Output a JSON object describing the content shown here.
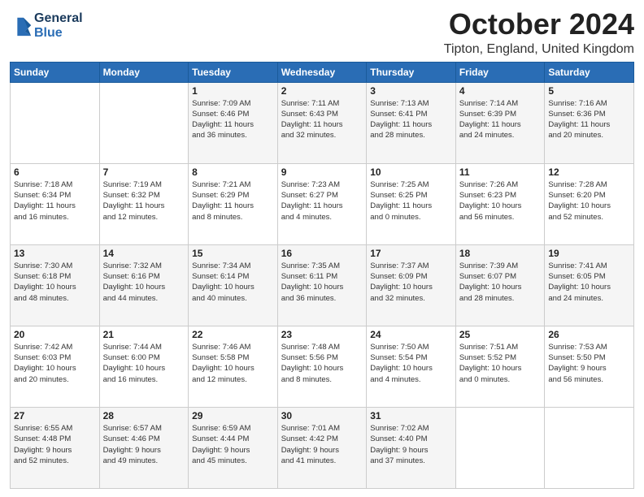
{
  "logo": {
    "line1": "General",
    "line2": "Blue"
  },
  "header": {
    "title": "October 2024",
    "location": "Tipton, England, United Kingdom"
  },
  "weekdays": [
    "Sunday",
    "Monday",
    "Tuesday",
    "Wednesday",
    "Thursday",
    "Friday",
    "Saturday"
  ],
  "weeks": [
    [
      {
        "day": "",
        "info": ""
      },
      {
        "day": "",
        "info": ""
      },
      {
        "day": "1",
        "info": "Sunrise: 7:09 AM\nSunset: 6:46 PM\nDaylight: 11 hours\nand 36 minutes."
      },
      {
        "day": "2",
        "info": "Sunrise: 7:11 AM\nSunset: 6:43 PM\nDaylight: 11 hours\nand 32 minutes."
      },
      {
        "day": "3",
        "info": "Sunrise: 7:13 AM\nSunset: 6:41 PM\nDaylight: 11 hours\nand 28 minutes."
      },
      {
        "day": "4",
        "info": "Sunrise: 7:14 AM\nSunset: 6:39 PM\nDaylight: 11 hours\nand 24 minutes."
      },
      {
        "day": "5",
        "info": "Sunrise: 7:16 AM\nSunset: 6:36 PM\nDaylight: 11 hours\nand 20 minutes."
      }
    ],
    [
      {
        "day": "6",
        "info": "Sunrise: 7:18 AM\nSunset: 6:34 PM\nDaylight: 11 hours\nand 16 minutes."
      },
      {
        "day": "7",
        "info": "Sunrise: 7:19 AM\nSunset: 6:32 PM\nDaylight: 11 hours\nand 12 minutes."
      },
      {
        "day": "8",
        "info": "Sunrise: 7:21 AM\nSunset: 6:29 PM\nDaylight: 11 hours\nand 8 minutes."
      },
      {
        "day": "9",
        "info": "Sunrise: 7:23 AM\nSunset: 6:27 PM\nDaylight: 11 hours\nand 4 minutes."
      },
      {
        "day": "10",
        "info": "Sunrise: 7:25 AM\nSunset: 6:25 PM\nDaylight: 11 hours\nand 0 minutes."
      },
      {
        "day": "11",
        "info": "Sunrise: 7:26 AM\nSunset: 6:23 PM\nDaylight: 10 hours\nand 56 minutes."
      },
      {
        "day": "12",
        "info": "Sunrise: 7:28 AM\nSunset: 6:20 PM\nDaylight: 10 hours\nand 52 minutes."
      }
    ],
    [
      {
        "day": "13",
        "info": "Sunrise: 7:30 AM\nSunset: 6:18 PM\nDaylight: 10 hours\nand 48 minutes."
      },
      {
        "day": "14",
        "info": "Sunrise: 7:32 AM\nSunset: 6:16 PM\nDaylight: 10 hours\nand 44 minutes."
      },
      {
        "day": "15",
        "info": "Sunrise: 7:34 AM\nSunset: 6:14 PM\nDaylight: 10 hours\nand 40 minutes."
      },
      {
        "day": "16",
        "info": "Sunrise: 7:35 AM\nSunset: 6:11 PM\nDaylight: 10 hours\nand 36 minutes."
      },
      {
        "day": "17",
        "info": "Sunrise: 7:37 AM\nSunset: 6:09 PM\nDaylight: 10 hours\nand 32 minutes."
      },
      {
        "day": "18",
        "info": "Sunrise: 7:39 AM\nSunset: 6:07 PM\nDaylight: 10 hours\nand 28 minutes."
      },
      {
        "day": "19",
        "info": "Sunrise: 7:41 AM\nSunset: 6:05 PM\nDaylight: 10 hours\nand 24 minutes."
      }
    ],
    [
      {
        "day": "20",
        "info": "Sunrise: 7:42 AM\nSunset: 6:03 PM\nDaylight: 10 hours\nand 20 minutes."
      },
      {
        "day": "21",
        "info": "Sunrise: 7:44 AM\nSunset: 6:00 PM\nDaylight: 10 hours\nand 16 minutes."
      },
      {
        "day": "22",
        "info": "Sunrise: 7:46 AM\nSunset: 5:58 PM\nDaylight: 10 hours\nand 12 minutes."
      },
      {
        "day": "23",
        "info": "Sunrise: 7:48 AM\nSunset: 5:56 PM\nDaylight: 10 hours\nand 8 minutes."
      },
      {
        "day": "24",
        "info": "Sunrise: 7:50 AM\nSunset: 5:54 PM\nDaylight: 10 hours\nand 4 minutes."
      },
      {
        "day": "25",
        "info": "Sunrise: 7:51 AM\nSunset: 5:52 PM\nDaylight: 10 hours\nand 0 minutes."
      },
      {
        "day": "26",
        "info": "Sunrise: 7:53 AM\nSunset: 5:50 PM\nDaylight: 9 hours\nand 56 minutes."
      }
    ],
    [
      {
        "day": "27",
        "info": "Sunrise: 6:55 AM\nSunset: 4:48 PM\nDaylight: 9 hours\nand 52 minutes."
      },
      {
        "day": "28",
        "info": "Sunrise: 6:57 AM\nSunset: 4:46 PM\nDaylight: 9 hours\nand 49 minutes."
      },
      {
        "day": "29",
        "info": "Sunrise: 6:59 AM\nSunset: 4:44 PM\nDaylight: 9 hours\nand 45 minutes."
      },
      {
        "day": "30",
        "info": "Sunrise: 7:01 AM\nSunset: 4:42 PM\nDaylight: 9 hours\nand 41 minutes."
      },
      {
        "day": "31",
        "info": "Sunrise: 7:02 AM\nSunset: 4:40 PM\nDaylight: 9 hours\nand 37 minutes."
      },
      {
        "day": "",
        "info": ""
      },
      {
        "day": "",
        "info": ""
      }
    ]
  ]
}
